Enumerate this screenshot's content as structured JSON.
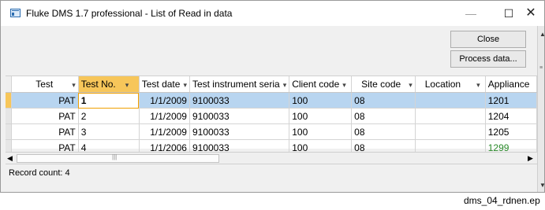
{
  "window": {
    "title": "Fluke DMS 1.7 professional - List of Read in data",
    "controls": {
      "minimize": "—",
      "maximize": "☐",
      "close": "✕"
    }
  },
  "buttons": {
    "close": "Close",
    "process": "Process data..."
  },
  "grid": {
    "columns": [
      "Test",
      "Test No.",
      "Test date",
      "Test instrument seria",
      "Client code",
      "Site code",
      "Location",
      "Appliance"
    ],
    "rows": [
      [
        "PAT",
        "1",
        "1/1/2009",
        "9100033",
        "100",
        "08",
        "",
        "1201"
      ],
      [
        "PAT",
        "2",
        "1/1/2009",
        "9100033",
        "100",
        "08",
        "",
        "1204"
      ],
      [
        "PAT",
        "3",
        "1/1/2009",
        "9100033",
        "100",
        "08",
        "",
        "1205"
      ],
      [
        "PAT",
        "4",
        "1/1/2006",
        "9100033",
        "100",
        "08",
        "",
        "1299"
      ]
    ],
    "selected_row": 0,
    "selected_column": "Test No."
  },
  "status": {
    "record_count": "Record count: 4"
  },
  "caption": "dms_04_rdnen.ep",
  "colors": {
    "selection": "#b8d5f0",
    "header_highlight": "#f7c65a",
    "highlight_value": "#2a8a2a"
  }
}
